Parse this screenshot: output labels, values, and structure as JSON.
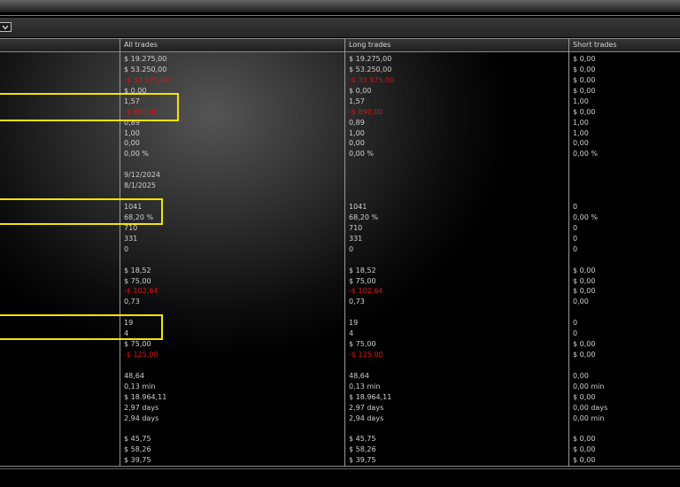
{
  "columns": [
    "All trades",
    "Long trades",
    "Short trades"
  ],
  "colors": {
    "negative": "#e01010",
    "highlight": "#f5e400"
  },
  "toolbar": {
    "dropdown_icon": "chevron-down-icon"
  },
  "rows": [
    {
      "all": "$ 19.275,00",
      "long": "$ 19.275,00",
      "short": "$ 0,00"
    },
    {
      "all": "$ 53.250,00",
      "long": "$ 53.250,00",
      "short": "$ 0,00"
    },
    {
      "all": "-$ 33.975,00",
      "long": "-$ 33.975,00",
      "short": "$ 0,00",
      "neg": true
    },
    {
      "all": "$ 0,00",
      "long": "$ 0,00",
      "short": "$ 0,00"
    },
    {
      "all": "1,57",
      "long": "1,57",
      "short": "1,00"
    },
    {
      "all": "-$ 890,00",
      "long": "-$ 890,00",
      "short": "$ 0,00",
      "neg": true
    },
    {
      "all": "0,89",
      "long": "0,89",
      "short": "1,00"
    },
    {
      "all": "1,00",
      "long": "1,00",
      "short": "1,00"
    },
    {
      "all": "0,00",
      "long": "0,00",
      "short": "0,00"
    },
    {
      "all": "0,00 %",
      "long": "0,00 %",
      "short": "0,00 %"
    },
    {
      "all": "",
      "long": "",
      "short": ""
    },
    {
      "all": "9/12/2024",
      "long": "",
      "short": ""
    },
    {
      "all": "8/1/2025",
      "long": "",
      "short": ""
    },
    {
      "all": "",
      "long": "",
      "short": ""
    },
    {
      "all": "1041",
      "long": "1041",
      "short": "0"
    },
    {
      "all": "68,20 %",
      "long": "68,20 %",
      "short": "0,00 %"
    },
    {
      "all": "710",
      "long": "710",
      "short": "0"
    },
    {
      "all": "331",
      "long": "331",
      "short": "0"
    },
    {
      "all": "0",
      "long": "0",
      "short": "0"
    },
    {
      "all": "",
      "long": "",
      "short": ""
    },
    {
      "all": "$ 18,52",
      "long": "$ 18,52",
      "short": "$ 0,00"
    },
    {
      "all": "$ 75,00",
      "long": "$ 75,00",
      "short": "$ 0,00"
    },
    {
      "all": "-$ 102,64",
      "long": "-$ 102,64",
      "short": "$ 0,00",
      "neg": true
    },
    {
      "all": "0,73",
      "long": "0,73",
      "short": "0,00"
    },
    {
      "all": "",
      "long": "",
      "short": ""
    },
    {
      "all": "19",
      "long": "19",
      "short": "0"
    },
    {
      "all": "4",
      "long": "4",
      "short": "0"
    },
    {
      "all": "$ 75,00",
      "long": "$ 75,00",
      "short": "$ 0,00"
    },
    {
      "all": "-$ 125,00",
      "long": "-$ 125,00",
      "short": "$ 0,00",
      "neg": true
    },
    {
      "all": "",
      "long": "",
      "short": ""
    },
    {
      "all": "48,64",
      "long": "48,64",
      "short": "0,00"
    },
    {
      "all": "0,13 min",
      "long": "0,13 min",
      "short": "0,00 min"
    },
    {
      "all": "$ 18.964,11",
      "long": "$ 18.964,11",
      "short": "$ 0,00"
    },
    {
      "all": "2,97 days",
      "long": "2,97 days",
      "short": "0,00 days"
    },
    {
      "all": "2,94 days",
      "long": "2,94 days",
      "short": "0,00 min"
    },
    {
      "all": "",
      "long": "",
      "short": ""
    },
    {
      "all": "$ 45,75",
      "long": "$ 45,75",
      "short": "$ 0,00"
    },
    {
      "all": "$ 58,26",
      "long": "$ 58,26",
      "short": "$ 0,00"
    },
    {
      "all": "$ 39,75",
      "long": "$ 39,75",
      "short": "$ 0,00"
    }
  ]
}
